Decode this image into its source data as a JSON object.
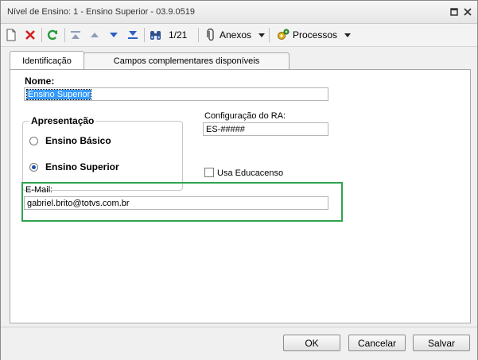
{
  "window": {
    "title": "Nível de Ensino: 1 - Ensino Superior - 03.9.0519"
  },
  "toolbar": {
    "record_counter": "1/21",
    "anexos_label": "Anexos",
    "processos_label": "Processos"
  },
  "tabs": [
    {
      "label": "Identificação",
      "active": true
    },
    {
      "label": "Campos complementares disponíveis",
      "active": false
    }
  ],
  "form": {
    "nome_label": "Nome:",
    "nome_value": "Ensino Superior",
    "apresentacao_title": "Apresentação",
    "options": [
      {
        "label": "Ensino Básico",
        "selected": false
      },
      {
        "label": "Ensino Superior",
        "selected": true
      }
    ],
    "config_ra_label": "Configuração do RA:",
    "config_ra_value": "ES-#####",
    "usa_educacenso_label": "Usa Educacenso",
    "usa_educacenso_checked": false,
    "email_label": "E-Mail:",
    "email_value": "gabriel.brito@totvs.com.br"
  },
  "footer": {
    "ok_label": "OK",
    "cancel_label": "Cancelar",
    "save_label": "Salvar"
  },
  "colors": {
    "highlight": "#2ea44f",
    "selection": "#3399ff",
    "radio_dot": "#1f4fa8"
  }
}
